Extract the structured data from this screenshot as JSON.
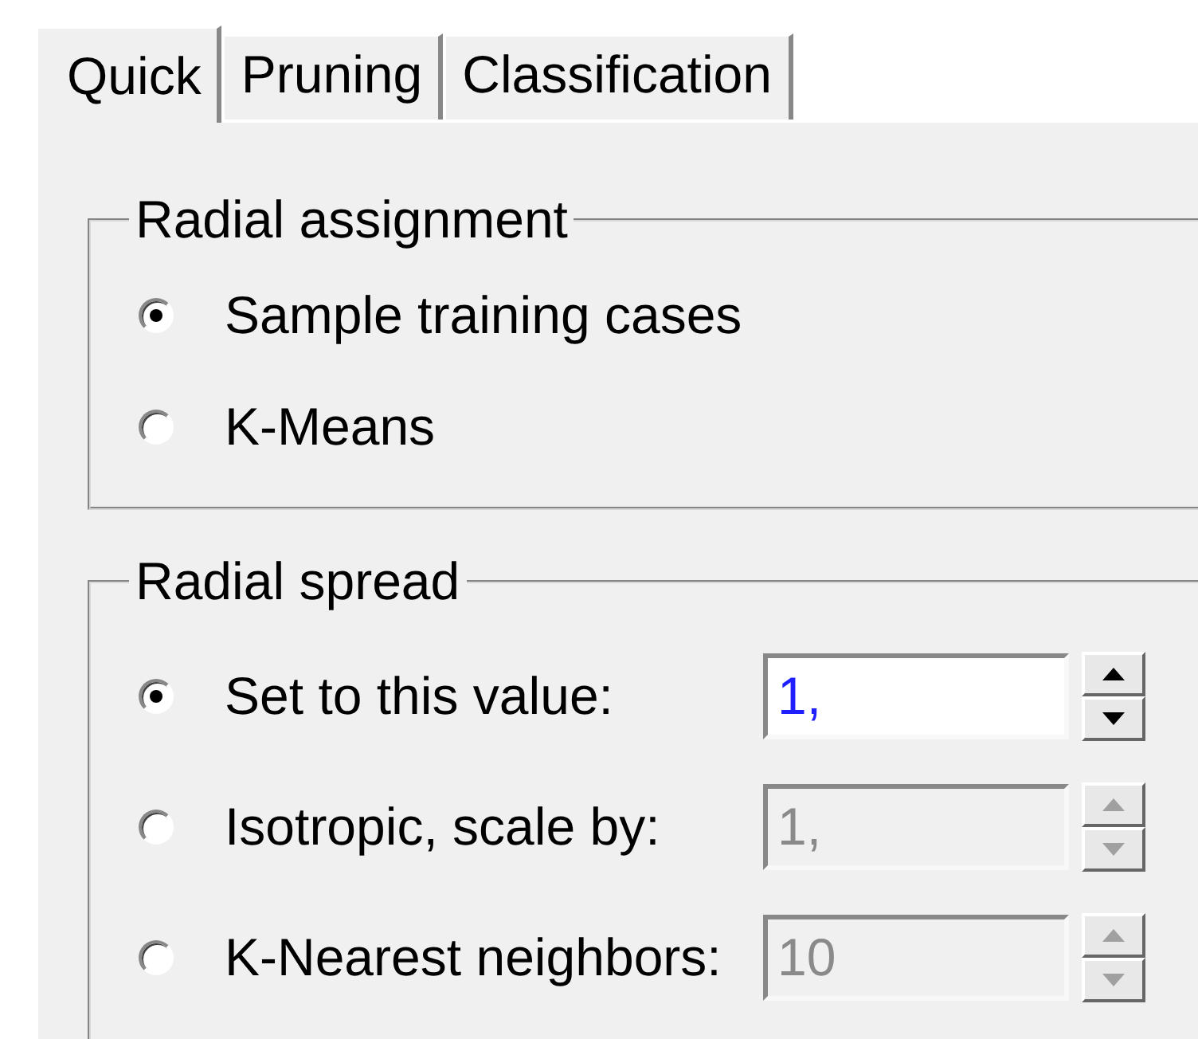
{
  "tabs": [
    {
      "label": "Quick",
      "selected": true
    },
    {
      "label": "Pruning",
      "selected": false
    },
    {
      "label": "Classification",
      "selected": false
    }
  ],
  "groups": [
    {
      "title": "Radial assignment",
      "options": [
        {
          "label": "Sample training cases",
          "selected": true
        },
        {
          "label": "K-Means",
          "selected": false
        }
      ]
    },
    {
      "title": "Radial spread",
      "options": [
        {
          "label": "Set to this value:",
          "selected": true,
          "field": {
            "value": "1,",
            "disabled": false
          }
        },
        {
          "label": "Isotropic, scale by:",
          "selected": false,
          "field": {
            "value": "1,",
            "disabled": true
          }
        },
        {
          "label": "K-Nearest neighbors:",
          "selected": false,
          "field": {
            "value": "10",
            "disabled": true
          }
        }
      ]
    }
  ]
}
